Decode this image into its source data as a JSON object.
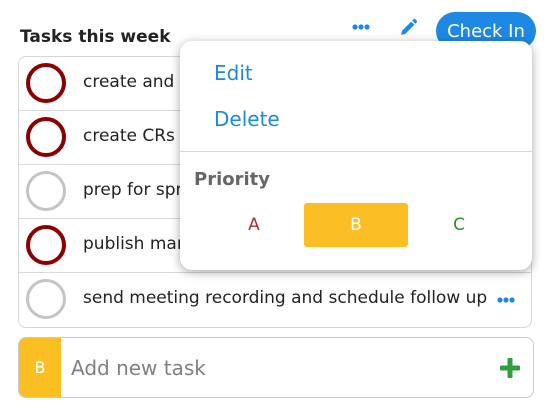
{
  "header": {
    "title": "Tasks this week",
    "check_in_label": "Check In"
  },
  "tasks": [
    {
      "text": "create and p",
      "status": "priority"
    },
    {
      "text": "create CRs fr",
      "status": "priority"
    },
    {
      "text": "prep for spri",
      "status": "normal"
    },
    {
      "text": "publish man",
      "status": "priority"
    },
    {
      "text": "send meeting recording and schedule follow up",
      "status": "normal"
    }
  ],
  "add_task": {
    "priority_badge": "B",
    "placeholder": "Add new task"
  },
  "popup_menu": {
    "edit_label": "Edit",
    "delete_label": "Delete",
    "priority_heading": "Priority",
    "options": [
      "A",
      "B",
      "C"
    ],
    "selected": "B"
  },
  "colors": {
    "accent_blue": "#1e88e5",
    "priority_red": "#8b0000",
    "priority_b_yellow": "#fbbf24",
    "priority_a_red": "#a93226",
    "priority_c_green": "#2e8b2e",
    "plus_green": "#2e9e3e"
  },
  "icons": {
    "more": "more-dots-icon",
    "edit": "pencil-icon",
    "add": "plus-icon"
  }
}
